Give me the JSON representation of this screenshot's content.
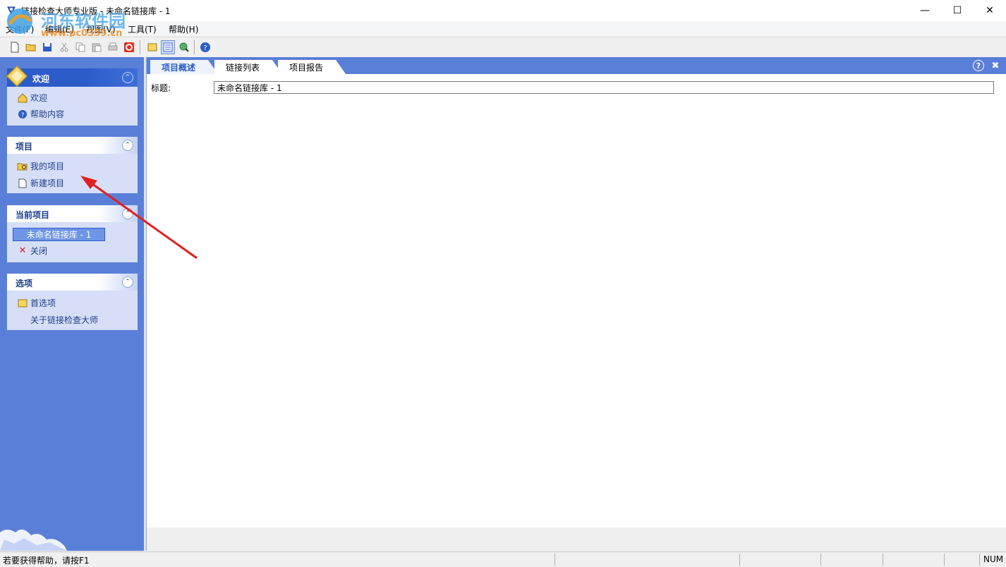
{
  "window": {
    "title": "链接检查大师专业版 - 未命名链接库 - 1",
    "minimize_glyph": "—",
    "maximize_glyph": "☐",
    "close_glyph": "✕"
  },
  "watermark": {
    "name": "河东软件园",
    "url": "www.pc0359.cn"
  },
  "menu": [
    {
      "label": "文件(F)"
    },
    {
      "label": "编辑(E)"
    },
    {
      "label": "视图(V)"
    },
    {
      "label": "工具(T)"
    },
    {
      "label": "帮助(H)"
    }
  ],
  "toolbar": {
    "icons": [
      "new-file-icon",
      "open-folder-icon",
      "save-icon",
      "cut-icon",
      "copy-icon",
      "paste-icon",
      "print-icon",
      "stop-icon",
      "options-icon",
      "list-view-icon",
      "check-links-icon",
      "help-icon"
    ],
    "active": "list-view-icon"
  },
  "sidebar": {
    "welcome": {
      "header": "欢迎",
      "items": [
        {
          "label": "欢迎",
          "icon": "home-icon"
        },
        {
          "label": "帮助内容",
          "icon": "help-icon"
        }
      ]
    },
    "project": {
      "header": "项目",
      "items": [
        {
          "label": "我的项目",
          "icon": "project-folder-icon"
        },
        {
          "label": "新建项目",
          "icon": "new-page-icon"
        }
      ]
    },
    "current": {
      "header": "当前项目",
      "items": [
        {
          "label": "未命名链接库 - 1",
          "selected": true
        },
        {
          "label": "关闭",
          "icon": "close-red-icon"
        }
      ]
    },
    "options": {
      "header": "选项",
      "items": [
        {
          "label": "首选项",
          "icon": "preferences-icon"
        },
        {
          "label": "关于链接检查大师"
        }
      ]
    }
  },
  "tabs": [
    {
      "label": "项目概述",
      "active": true
    },
    {
      "label": "链接列表",
      "active": false
    },
    {
      "label": "项目报告",
      "active": false
    }
  ],
  "tab_controls": {
    "help": "?",
    "close": "✖"
  },
  "form": {
    "title_label": "标题:",
    "title_value": "未命名链接库 - 1"
  },
  "statusbar": {
    "text": "若要获得帮助，请按F1",
    "indicator": "NUM"
  },
  "colors": {
    "sidebar": "#5a7fd8",
    "panel": "#d6dff7",
    "accent": "#2c5cc8",
    "arrow": "#e02020"
  }
}
